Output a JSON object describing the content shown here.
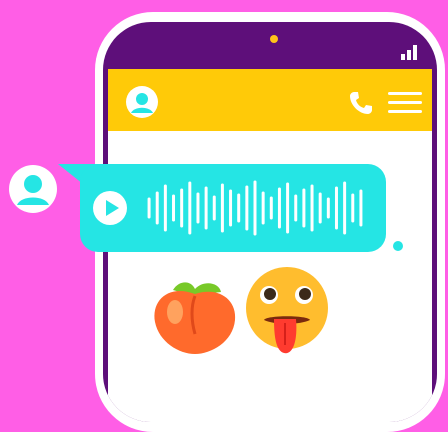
{
  "colors": {
    "background": "#ff5ee6",
    "phone_frame": "#5e0f7a",
    "appbar": "#ffca08",
    "bubble": "#25e5e4",
    "accent_dot": "#ffc31a"
  },
  "status_bar": {
    "signal_icon": "signal-bars-icon",
    "signal_level": 3
  },
  "appbar": {
    "avatar_icon": "user-avatar-icon",
    "call_icon": "phone-icon",
    "menu_icon": "hamburger-menu-icon"
  },
  "message": {
    "type": "voice",
    "sender_avatar_icon": "user-avatar-icon",
    "play_icon": "play-icon",
    "waveform_icon": "waveform-icon"
  },
  "reactions": [
    "peach-emoji",
    "tongue-out-face-emoji"
  ]
}
